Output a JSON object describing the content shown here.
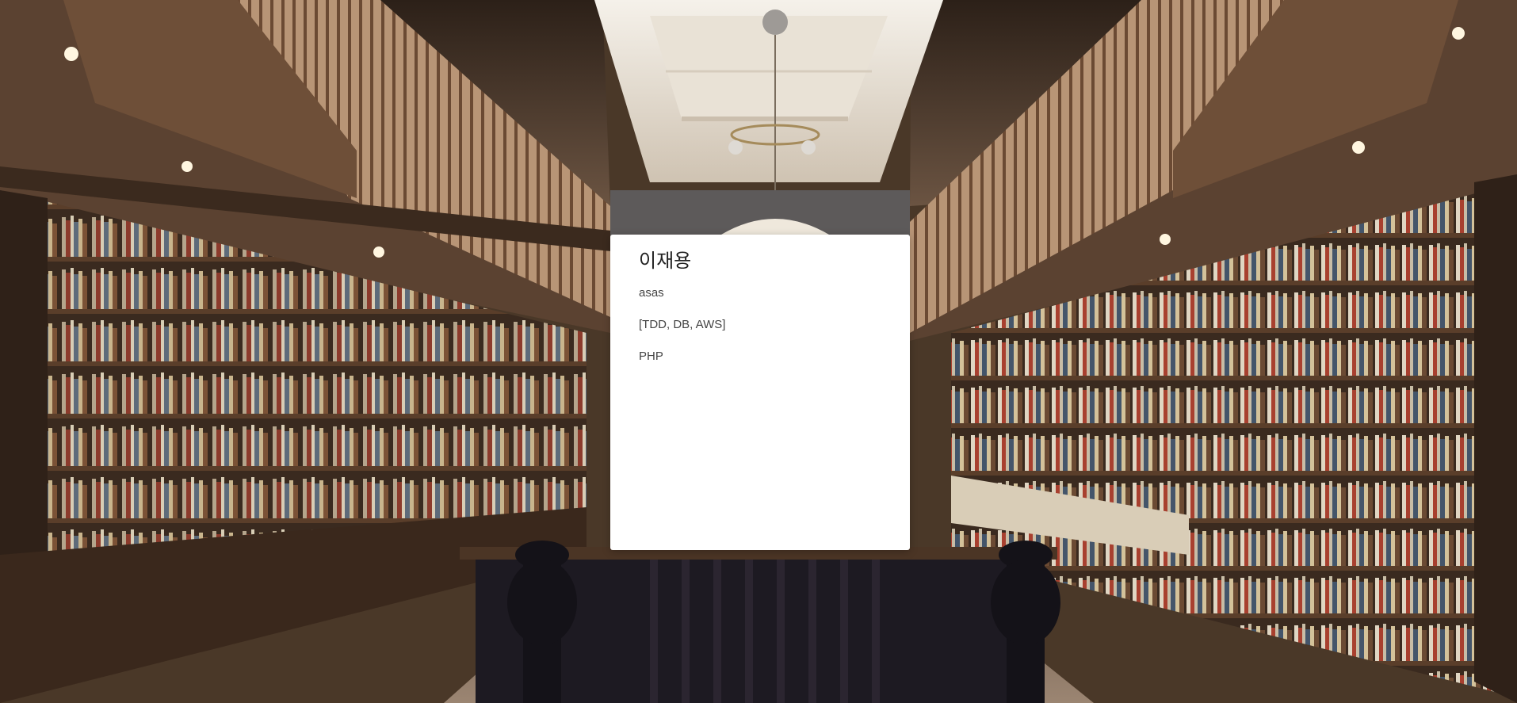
{
  "profile_card": {
    "name": "이재용",
    "description": "asas",
    "skills": "[TDD, DB, AWS]",
    "language": "PHP"
  },
  "background": {
    "scene": "library-interior-photo",
    "colors": {
      "wood_dark": "#3b2a1e",
      "wood_mid": "#7a5a3e",
      "skylight": "#f2ece2",
      "floor": "#8a7462"
    }
  }
}
